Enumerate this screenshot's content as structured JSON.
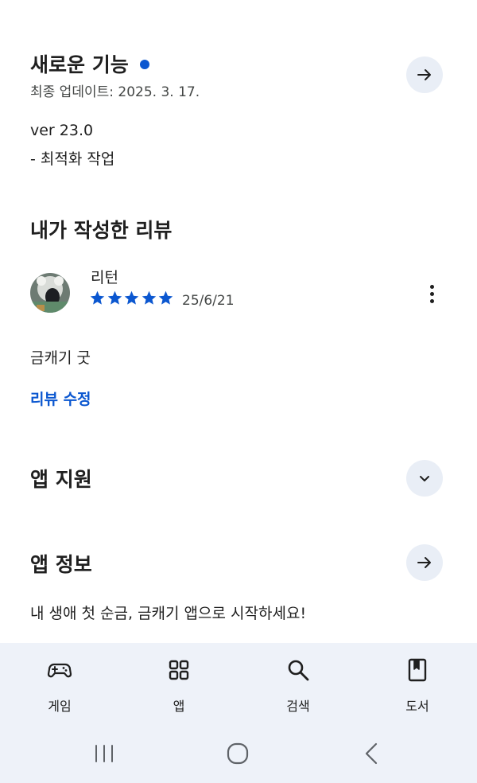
{
  "whats_new": {
    "title": "새로운 기능",
    "last_updated": "최종 업데이트: 2025. 3. 17.",
    "version": "ver 23.0",
    "notes": "- 최적화 작업"
  },
  "my_review": {
    "title": "내가 작성한 리뷰",
    "reviewer_name": "리턴",
    "rating": 5,
    "date": "25/6/21",
    "text": "금캐기 굿",
    "edit_label": "리뷰 수정"
  },
  "app_support": {
    "title": "앱 지원"
  },
  "app_info": {
    "title": "앱 정보",
    "description": "내 생애 첫 순금, 금캐기 앱으로 시작하세요!"
  },
  "bottom_nav": {
    "items": [
      {
        "label": "게임",
        "icon": "gamepad-icon"
      },
      {
        "label": "앱",
        "icon": "apps-grid-icon"
      },
      {
        "label": "검색",
        "icon": "search-icon"
      },
      {
        "label": "도서",
        "icon": "book-icon"
      }
    ]
  },
  "colors": {
    "accent": "#0b57d0",
    "button_bg": "#e9eef6",
    "nav_bg": "#eef2f9"
  }
}
